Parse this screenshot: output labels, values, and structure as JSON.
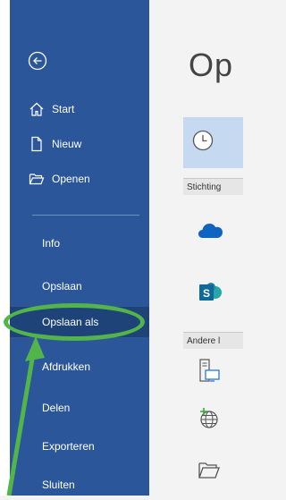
{
  "sidebar": {
    "back_icon": "back-arrow-circle-icon",
    "primary": [
      {
        "label": "Start",
        "icon": "home-icon"
      },
      {
        "label": "Nieuw",
        "icon": "new-document-icon"
      },
      {
        "label": "Openen",
        "icon": "open-folder-icon"
      }
    ],
    "secondary": [
      {
        "label": "Info"
      },
      {
        "label": "Opslaan"
      },
      {
        "label": "Opslaan als",
        "selected": true
      },
      {
        "label": "Afdrukken"
      },
      {
        "label": "Delen"
      },
      {
        "label": "Exporteren"
      },
      {
        "label": "Sluiten"
      }
    ],
    "background_color": "#2b579a",
    "selected_color": "#1e4379"
  },
  "main": {
    "title": "Op",
    "sections": [
      {
        "label": "Stichting"
      },
      {
        "label": "Andere l"
      }
    ],
    "locations": [
      {
        "icon": "clock-icon"
      },
      {
        "icon": "onedrive-cloud-icon"
      },
      {
        "icon": "sharepoint-icon"
      },
      {
        "icon": "this-pc-icon"
      },
      {
        "icon": "add-place-globe-icon"
      },
      {
        "icon": "browse-folder-icon"
      }
    ]
  },
  "annotation": {
    "highlight_color": "#53b449"
  }
}
